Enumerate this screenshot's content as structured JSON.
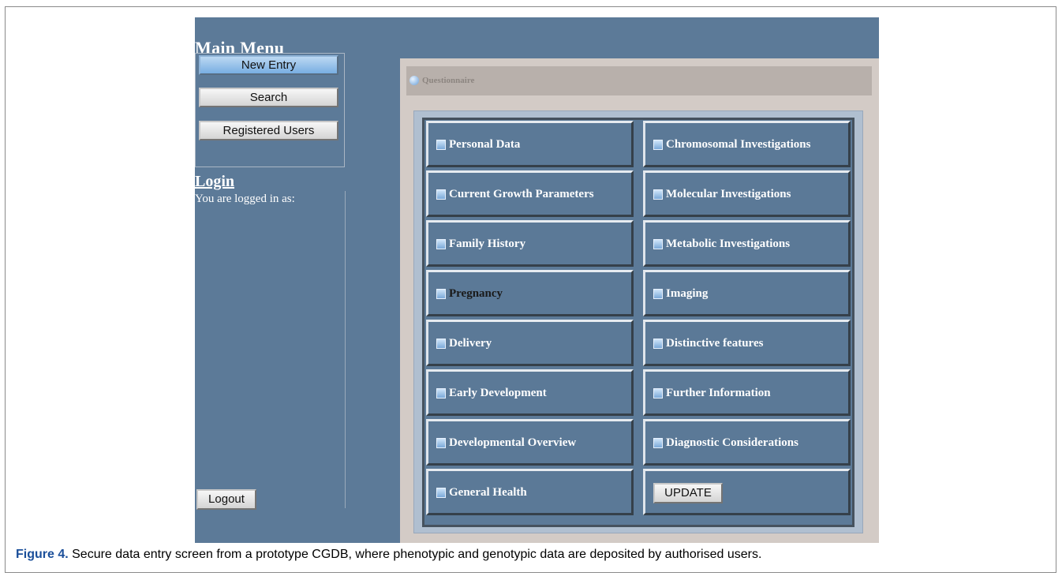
{
  "sidebar": {
    "title": "Main Menu",
    "items": [
      {
        "label": "New Entry"
      },
      {
        "label": "Search"
      },
      {
        "label": "Registered Users"
      }
    ],
    "login_title": "Login",
    "login_status": "You are logged in as:",
    "logout_label": "Logout"
  },
  "questionnaire": {
    "title": "Questionnaire",
    "left_items": [
      "Personal Data",
      "Current Growth Parameters",
      "Family History",
      "Pregnancy",
      "Delivery",
      "Early Development",
      "Developmental Overview",
      "General Health"
    ],
    "right_items": [
      "Chromosomal Investigations",
      "Molecular Investigations",
      "Metabolic Investigations",
      "Imaging",
      "Distinctive features",
      "Further Information",
      "Diagnostic Considerations"
    ],
    "update_label": "UPDATE"
  },
  "caption": {
    "label": "Figure 4.",
    "text": " Secure data entry screen from a prototype CGDB, where phenotypic and genotypic data are deposited by authorised users."
  },
  "colors": {
    "screen_bg": "#5c7a98",
    "panel_bg": "#d3cbc6",
    "active_button": "#78aee2",
    "caption_label": "#1b4f9a"
  }
}
